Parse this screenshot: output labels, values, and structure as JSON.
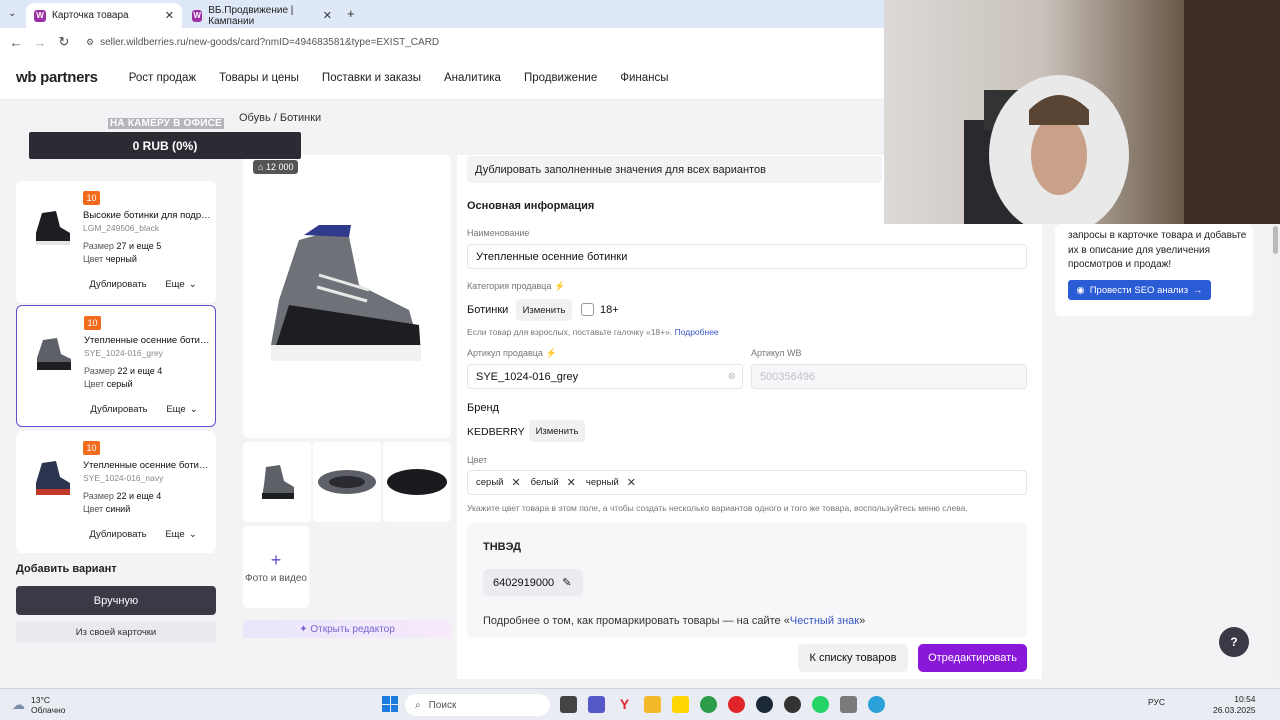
{
  "browser": {
    "tabs": [
      {
        "label": "Карточка товара",
        "active": true
      },
      {
        "label": "ВБ.Продвижение | Кампании",
        "active": false
      }
    ],
    "url": "seller.wildberries.ru/new-goods/card?nmID=494683581&type=EXIST_CARD"
  },
  "header": {
    "logo": "wb partners",
    "nav": [
      "Рост продаж",
      "Товары и цены",
      "Поставки и заказы",
      "Аналитика",
      "Продвижение",
      "Финансы"
    ]
  },
  "sidebar": {
    "promo_text": "НА КАМЕРУ В ОФИСЕ",
    "balance": "0 RUB (0%)",
    "cards": [
      {
        "badge": "10",
        "title": "Высокие ботинки для подро...",
        "sku": "LGM_249506_black",
        "size_label": "Размер",
        "size": "27 и еще 5",
        "color_label": "Цвет",
        "color": "черный",
        "dup": "Дублировать",
        "more": "Еще"
      },
      {
        "badge": "10",
        "title": "Утепленные осенние ботинки",
        "sku": "SYE_1024-016_grey",
        "size_label": "Размер",
        "size": "22 и еще 4",
        "color_label": "Цвет",
        "color": "серый",
        "dup": "Дублировать",
        "more": "Еще"
      },
      {
        "badge": "10",
        "title": "Утепленные осенние ботинки",
        "sku": "SYE_1024-016_navy",
        "size_label": "Размер",
        "size": "22 и еще 4",
        "color_label": "Цвет",
        "color": "синий",
        "dup": "Дублировать",
        "more": "Еще"
      }
    ],
    "add_variant": "Добавить вариант",
    "manual_btn": "Вручную",
    "from_card_btn": "Из своей карточки"
  },
  "breadcrumb": "Обувь / Ботинки",
  "gallery": {
    "price_tag": "12 000",
    "add_photo": "Фото и видео",
    "editor": "Открыть редактор"
  },
  "form": {
    "dup_all": "Дублировать заполненные значения для всех вариантов",
    "section_title": "Основная информация",
    "name_label": "Наименование",
    "name_value": "Утепленные осенние ботинки",
    "category_label": "Категория продавца",
    "category_value": "Ботинки",
    "change": "Изменить",
    "adult_label": "18+",
    "adult_hint": "Если товар для взрослых, поставьте галочку «18+».",
    "more_link": "Подробнее",
    "seller_sku_label": "Артикул продавца",
    "seller_sku": "SYE_1024-016_grey",
    "wb_sku_label": "Артикул WB",
    "wb_sku": "500356496",
    "brand_label": "Бренд",
    "brand_value": "KEDBERRY",
    "color_label": "Цвет",
    "colors": [
      "серый",
      "белый",
      "черный"
    ],
    "color_hint": "Укажите цвет товара в этом поле, а чтобы создать несколько вариантов одного и того же товара, воспользуйтесь меню слева.",
    "tnved_title": "ТНВЭД",
    "tnved_code": "6402919000",
    "marking_text": "Подробнее о том, как промаркировать товары — на сайте «",
    "marking_link": "Честный знак",
    "marking_end": "»"
  },
  "actions": {
    "to_list": "К списку товаров",
    "edit": "Отредактировать"
  },
  "seo": {
    "text": "запросы в карточке товара и добавьте их в описание для увеличения просмотров и продаж!",
    "button": "Провести SEO анализ"
  },
  "help": "?",
  "taskbar": {
    "temp": "13°C",
    "weather": "Облачно",
    "search": "Поиск",
    "lang": "РУС",
    "time": "10:54",
    "date": "26.03.2025"
  },
  "colors": {
    "accent": "#8a18d8",
    "badge": "#f26a1b",
    "link": "#3a57c5"
  }
}
